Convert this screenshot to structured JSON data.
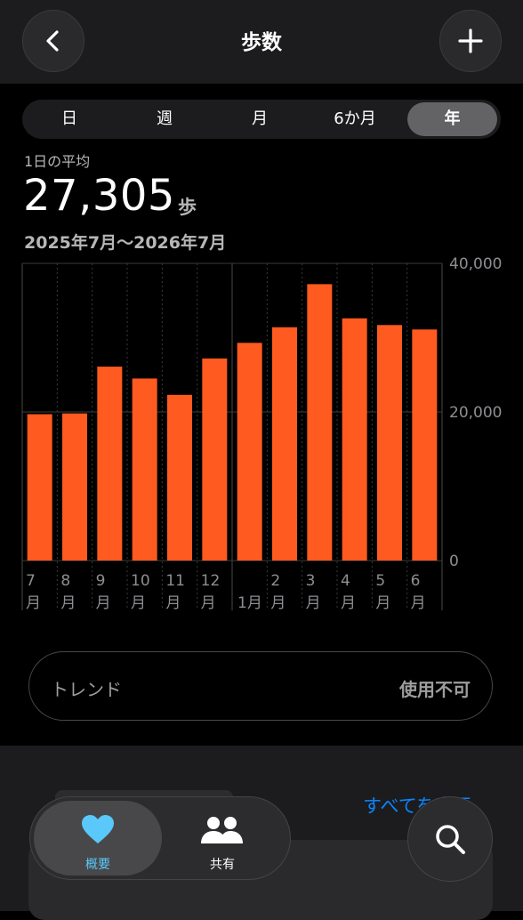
{
  "nav": {
    "title": "歩数"
  },
  "segments": [
    {
      "label": "日",
      "active": false
    },
    {
      "label": "週",
      "active": false
    },
    {
      "label": "月",
      "active": false
    },
    {
      "label": "6か月",
      "active": false
    },
    {
      "label": "年",
      "active": true
    }
  ],
  "summary": {
    "avg_label": "1日の平均",
    "avg_value": "27,305",
    "avg_unit": "歩",
    "range": "2025年7月〜2026年7月"
  },
  "chart_data": {
    "type": "bar",
    "categories": [
      "7月",
      "8月",
      "9月",
      "10月",
      "11月",
      "12月",
      "1月",
      "2月",
      "3月",
      "4月",
      "5月",
      "6月"
    ],
    "values": [
      19700,
      19800,
      26100,
      24500,
      22300,
      27200,
      29300,
      31400,
      37200,
      32600,
      31700,
      31100
    ],
    "ylim": [
      0,
      40000
    ],
    "y_ticks": [
      "0",
      "20,000",
      "40,000"
    ],
    "bar_color": "#ff5a1f",
    "grid": true
  },
  "trend": {
    "label": "トレンド",
    "value": "使用不可"
  },
  "highlights": {
    "see_all": "すべてを表示"
  },
  "tabs": [
    {
      "label": "概要",
      "icon": "heart-icon",
      "active": true,
      "color": "#5ac8fa"
    },
    {
      "label": "共有",
      "icon": "people-icon",
      "active": false
    }
  ],
  "colors": {
    "accent": "#0a84ff",
    "bars": "#ff5a1f"
  }
}
